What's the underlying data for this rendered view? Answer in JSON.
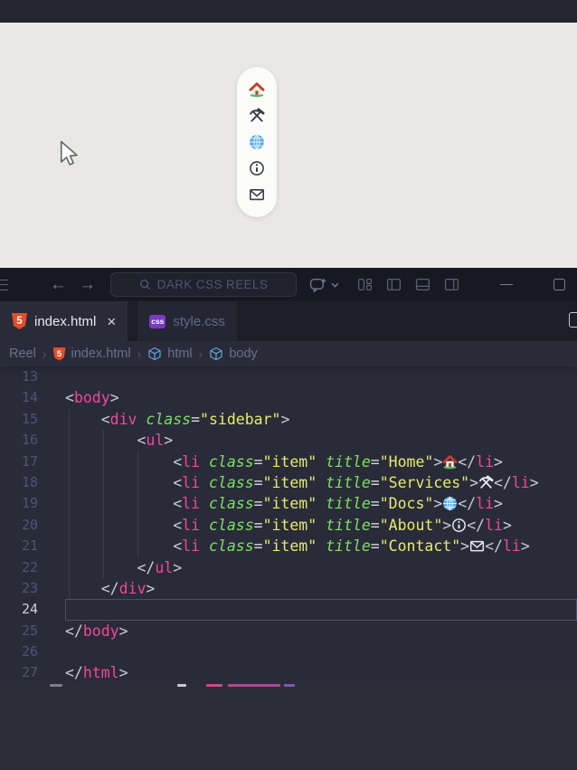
{
  "colors": {
    "editor_bg": "#292b38",
    "titlebar_bg": "#171922",
    "tabstrip_bg": "#1b1d27",
    "preview_bg": "#e9e8e5",
    "syntax_tag": "#f1479c",
    "syntax_attr": "#7de063",
    "syntax_string": "#e6eb6e",
    "syntax_punct": "#c9cdd8",
    "line_number": "#4c5577",
    "html_badge_orange": "#e44d26",
    "css_badge_purple": "#7a3bbf",
    "symbol_icon_blue": "#64a2dd"
  },
  "preview": {
    "nav_items": [
      {
        "name": "home",
        "icon": "home"
      },
      {
        "name": "services",
        "icon": "tools"
      },
      {
        "name": "docs",
        "icon": "globe"
      },
      {
        "name": "about",
        "icon": "info"
      },
      {
        "name": "contact",
        "icon": "mail"
      }
    ]
  },
  "titlebar": {
    "search_label": "DARK CSS REELS"
  },
  "tabs": [
    {
      "label": "index.html",
      "badge": "5",
      "badge_type": "html",
      "active": true,
      "close_glyph": "×"
    },
    {
      "label": "style.css",
      "badge": "css",
      "badge_type": "css",
      "active": false
    }
  ],
  "breadcrumb": {
    "separator": "›",
    "items": [
      {
        "label": "Reel"
      },
      {
        "label": "index.html",
        "icon": "html-badge"
      },
      {
        "label": "html",
        "icon": "cube"
      },
      {
        "label": "body",
        "icon": "cube"
      }
    ]
  },
  "editor": {
    "lines": [
      {
        "num": "13",
        "tokens": []
      },
      {
        "num": "14",
        "tokens": [
          {
            "t": "punct",
            "v": "<"
          },
          {
            "t": "tag",
            "v": "body"
          },
          {
            "t": "punct",
            "v": ">"
          }
        ]
      },
      {
        "num": "15",
        "tokens": [
          {
            "t": "punct",
            "v": "    <"
          },
          {
            "t": "tag",
            "v": "div"
          },
          {
            "t": "plain",
            "v": " "
          },
          {
            "t": "attr",
            "v": "class"
          },
          {
            "t": "eq",
            "v": "="
          },
          {
            "t": "str",
            "v": "\"sidebar\""
          },
          {
            "t": "punct",
            "v": ">"
          }
        ]
      },
      {
        "num": "16",
        "tokens": [
          {
            "t": "punct",
            "v": "        <"
          },
          {
            "t": "tag",
            "v": "ul"
          },
          {
            "t": "punct",
            "v": ">"
          }
        ]
      },
      {
        "num": "17",
        "tokens": [
          {
            "t": "punct",
            "v": "            <"
          },
          {
            "t": "tag",
            "v": "li"
          },
          {
            "t": "plain",
            "v": " "
          },
          {
            "t": "attr",
            "v": "class"
          },
          {
            "t": "eq",
            "v": "="
          },
          {
            "t": "str",
            "v": "\"item\""
          },
          {
            "t": "plain",
            "v": " "
          },
          {
            "t": "attr",
            "v": "title"
          },
          {
            "t": "eq",
            "v": "="
          },
          {
            "t": "str",
            "v": "\"Home\""
          },
          {
            "t": "punct",
            "v": ">"
          },
          {
            "t": "icon",
            "v": "home"
          },
          {
            "t": "punct",
            "v": "</"
          },
          {
            "t": "tag",
            "v": "li"
          },
          {
            "t": "punct",
            "v": ">"
          }
        ]
      },
      {
        "num": "18",
        "tokens": [
          {
            "t": "punct",
            "v": "            <"
          },
          {
            "t": "tag",
            "v": "li"
          },
          {
            "t": "plain",
            "v": " "
          },
          {
            "t": "attr",
            "v": "class"
          },
          {
            "t": "eq",
            "v": "="
          },
          {
            "t": "str",
            "v": "\"item\""
          },
          {
            "t": "plain",
            "v": " "
          },
          {
            "t": "attr",
            "v": "title"
          },
          {
            "t": "eq",
            "v": "="
          },
          {
            "t": "str",
            "v": "\"Services\""
          },
          {
            "t": "punct",
            "v": ">"
          },
          {
            "t": "icon",
            "v": "tools"
          },
          {
            "t": "punct",
            "v": "</"
          },
          {
            "t": "tag",
            "v": "li"
          },
          {
            "t": "punct",
            "v": ">"
          }
        ]
      },
      {
        "num": "19",
        "tokens": [
          {
            "t": "punct",
            "v": "            <"
          },
          {
            "t": "tag",
            "v": "li"
          },
          {
            "t": "plain",
            "v": " "
          },
          {
            "t": "attr",
            "v": "class"
          },
          {
            "t": "eq",
            "v": "="
          },
          {
            "t": "str",
            "v": "\"item\""
          },
          {
            "t": "plain",
            "v": " "
          },
          {
            "t": "attr",
            "v": "title"
          },
          {
            "t": "eq",
            "v": "="
          },
          {
            "t": "str",
            "v": "\"Docs\""
          },
          {
            "t": "punct",
            "v": ">"
          },
          {
            "t": "icon",
            "v": "globe"
          },
          {
            "t": "punct",
            "v": "</"
          },
          {
            "t": "tag",
            "v": "li"
          },
          {
            "t": "punct",
            "v": ">"
          }
        ]
      },
      {
        "num": "20",
        "tokens": [
          {
            "t": "punct",
            "v": "            <"
          },
          {
            "t": "tag",
            "v": "li"
          },
          {
            "t": "plain",
            "v": " "
          },
          {
            "t": "attr",
            "v": "class"
          },
          {
            "t": "eq",
            "v": "="
          },
          {
            "t": "str",
            "v": "\"item\""
          },
          {
            "t": "plain",
            "v": " "
          },
          {
            "t": "attr",
            "v": "title"
          },
          {
            "t": "eq",
            "v": "="
          },
          {
            "t": "str",
            "v": "\"About\""
          },
          {
            "t": "punct",
            "v": ">"
          },
          {
            "t": "icon",
            "v": "info"
          },
          {
            "t": "punct",
            "v": "</"
          },
          {
            "t": "tag",
            "v": "li"
          },
          {
            "t": "punct",
            "v": ">"
          }
        ]
      },
      {
        "num": "21",
        "tokens": [
          {
            "t": "punct",
            "v": "            <"
          },
          {
            "t": "tag",
            "v": "li"
          },
          {
            "t": "plain",
            "v": " "
          },
          {
            "t": "attr",
            "v": "class"
          },
          {
            "t": "eq",
            "v": "="
          },
          {
            "t": "str",
            "v": "\"item\""
          },
          {
            "t": "plain",
            "v": " "
          },
          {
            "t": "attr",
            "v": "title"
          },
          {
            "t": "eq",
            "v": "="
          },
          {
            "t": "str",
            "v": "\"Contact\""
          },
          {
            "t": "punct",
            "v": ">"
          },
          {
            "t": "icon",
            "v": "mail"
          },
          {
            "t": "punct",
            "v": "</"
          },
          {
            "t": "tag",
            "v": "li"
          },
          {
            "t": "punct",
            "v": ">"
          }
        ]
      },
      {
        "num": "22",
        "tokens": [
          {
            "t": "punct",
            "v": "        </"
          },
          {
            "t": "tag",
            "v": "ul"
          },
          {
            "t": "punct",
            "v": ">"
          }
        ]
      },
      {
        "num": "23",
        "tokens": [
          {
            "t": "punct",
            "v": "    </"
          },
          {
            "t": "tag",
            "v": "div"
          },
          {
            "t": "punct",
            "v": ">"
          }
        ]
      },
      {
        "num": "24",
        "active": true,
        "tokens": []
      },
      {
        "num": "25",
        "tokens": [
          {
            "t": "punct",
            "v": "</"
          },
          {
            "t": "tag",
            "v": "body"
          },
          {
            "t": "punct",
            "v": ">"
          }
        ]
      },
      {
        "num": "26",
        "tokens": []
      },
      {
        "num": "27",
        "tokens": [
          {
            "t": "punct",
            "v": "</"
          },
          {
            "t": "tag",
            "v": "html"
          },
          {
            "t": "punct",
            "v": ">"
          }
        ]
      }
    ]
  }
}
